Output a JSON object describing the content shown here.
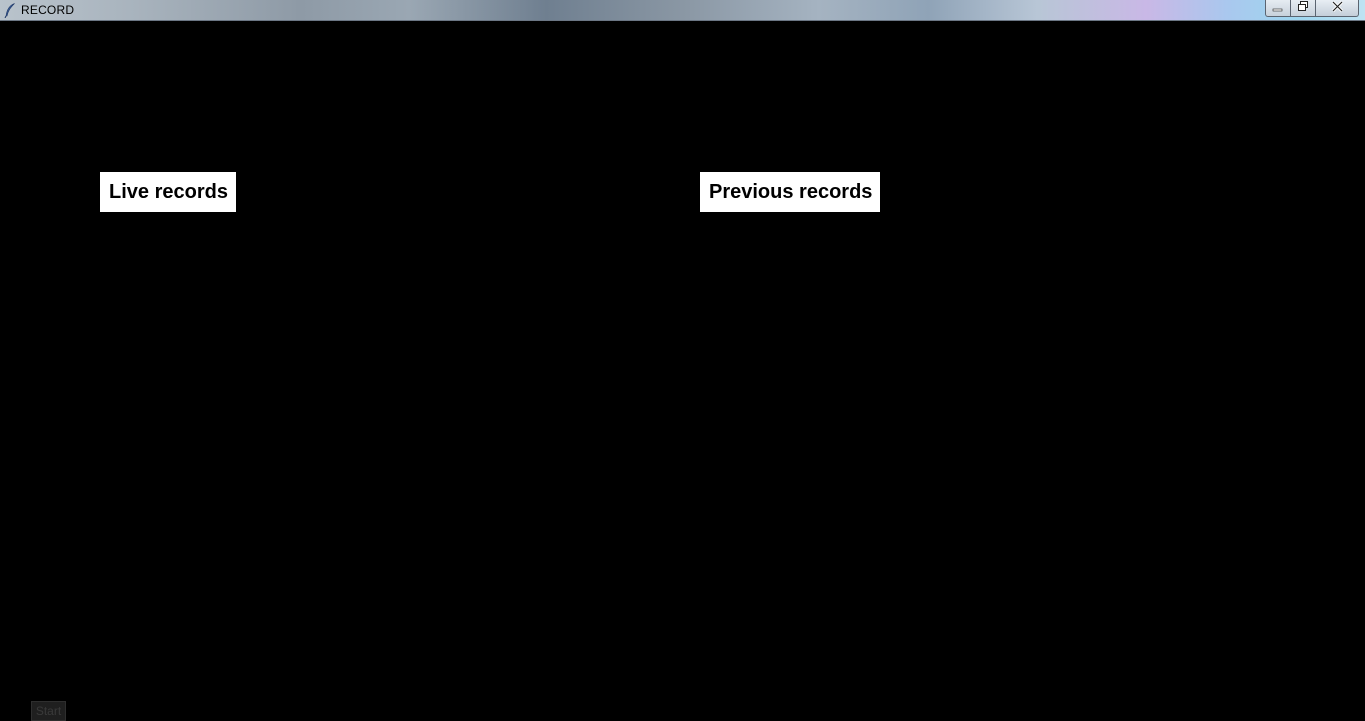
{
  "window": {
    "title": "RECORD",
    "controls": {
      "minimize_icon": "minimize-icon",
      "maximize_icon": "restore-icon",
      "close_icon": "close-icon"
    },
    "app_icon": "feather-icon"
  },
  "main": {
    "live_label": "Live records",
    "previous_label": "Previous records",
    "start_button": "Start"
  },
  "colors": {
    "background": "#000000",
    "label_background": "#ffffff",
    "label_text": "#000000"
  }
}
